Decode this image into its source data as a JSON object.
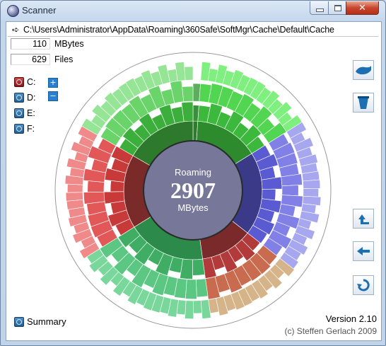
{
  "window": {
    "title": "Scanner"
  },
  "path": {
    "arrow_icon": "arrow-right-icon",
    "text": "C:\\Users\\Administrator\\AppData\\Roaming\\360Safe\\SoftMgr\\Cache\\Default\\Cache"
  },
  "stats": {
    "size_value": "110",
    "size_unit": "MBytes",
    "files_value": "629",
    "files_unit": "Files"
  },
  "drives": [
    {
      "label": "C:",
      "selected": true
    },
    {
      "label": "D:",
      "selected": false
    },
    {
      "label": "E:",
      "selected": false
    },
    {
      "label": "F:",
      "selected": false
    }
  ],
  "zoom": {
    "plus": "+",
    "minus": "−"
  },
  "center": {
    "name": "Roaming",
    "value": "2907",
    "unit": "MBytes"
  },
  "toolbar": [
    "scan-icon",
    "trash-icon",
    "up-icon",
    "back-icon",
    "refresh-icon"
  ],
  "footer": {
    "summary_label": "Summary",
    "version": "Version 2.10",
    "copyright": "(c) Steffen Gerlach 2009"
  },
  "colors": {
    "green": "#3cb83c",
    "blue": "#5a5ad2",
    "red": "#d64040",
    "teal": "#2f9e5a",
    "olive": "#8a7a30",
    "hub": "#767799"
  }
}
